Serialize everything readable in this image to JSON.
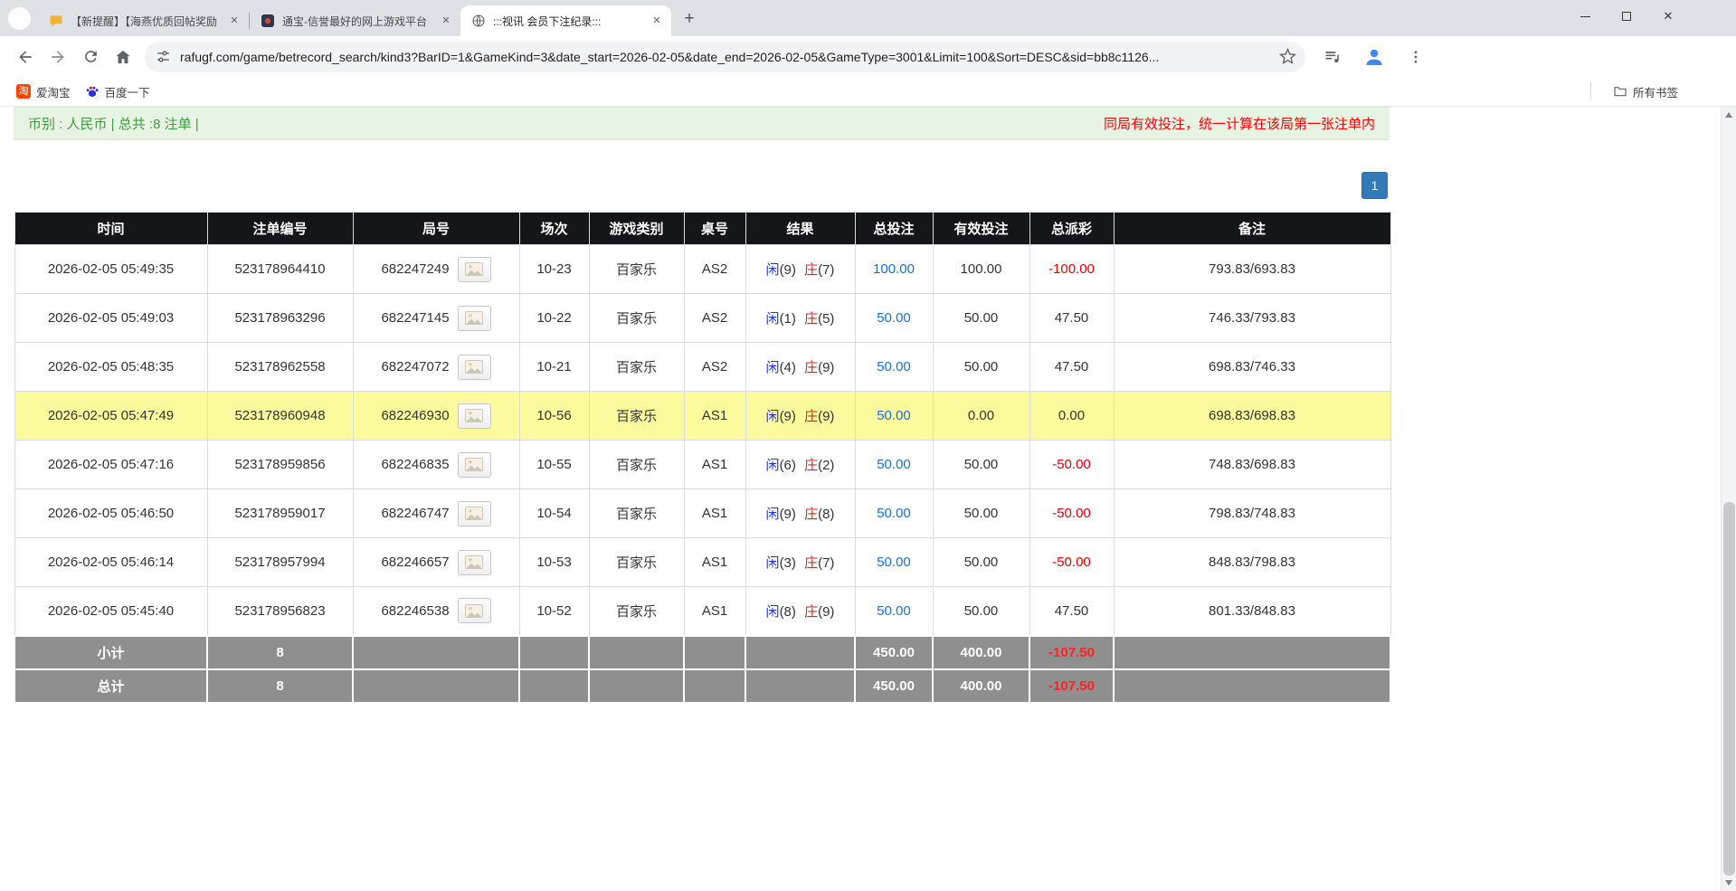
{
  "browser": {
    "tabs": [
      {
        "title": "【新提醒】【海燕优质回帖奖励"
      },
      {
        "title": "通宝-信誉最好的网上游戏平台"
      },
      {
        "title": ":::视讯 会员下注纪录:::"
      }
    ],
    "tab_close": "✕",
    "new_tab": "+",
    "window_close": "✕",
    "url": "rafugf.com/game/betrecord_search/kind3?BarID=1&GameKind=3&date_start=2026-02-05&date_end=2026-02-05&GameType=3001&Limit=100&Sort=DESC&sid=bb8c1126...",
    "bookmarks": [
      {
        "label": "爱淘宝",
        "icon_glyph": "淘"
      },
      {
        "label": "百度一下"
      }
    ],
    "all_bookmarks": "所有书签"
  },
  "icons": {
    "back": "arrow-left",
    "forward": "arrow-right",
    "refresh": "circular-arrow",
    "home": "house",
    "site-info": "sliders",
    "bookmark-star": "star-outline",
    "media-controls": "equalizer-note",
    "profile": "blue-person",
    "menu": "three-dots",
    "all-bookmarks": "folder",
    "active-tab": "globe",
    "replay": "picture"
  },
  "page": {
    "notice_left": "币别 : 人民币 | 总共 :8 注单 |",
    "notice_right": "同局有效投注，统一计算在该局第一张注单内",
    "pagination": "1"
  },
  "table": {
    "headers": [
      "时间",
      "注单编号",
      "局号",
      "场次",
      "游戏类别",
      "桌号",
      "结果",
      "总投注",
      "有效投注",
      "总派彩",
      "备注"
    ],
    "rows": [
      {
        "time": "2026-02-05 05:49:35",
        "bet_id": "523178964410",
        "round": "682247249",
        "session": "10-23",
        "game": "百家乐",
        "table_no": "AS2",
        "result_player": "闲(9)",
        "result_banker": "庄(7)",
        "total_bet": "100.00",
        "valid_bet": "100.00",
        "payout": "-100.00",
        "note": "793.83/693.83",
        "highlight": false
      },
      {
        "time": "2026-02-05 05:49:03",
        "bet_id": "523178963296",
        "round": "682247145",
        "session": "10-22",
        "game": "百家乐",
        "table_no": "AS2",
        "result_player": "闲(1)",
        "result_banker": "庄(5)",
        "total_bet": "50.00",
        "valid_bet": "50.00",
        "payout": "47.50",
        "note": "746.33/793.83",
        "highlight": false
      },
      {
        "time": "2026-02-05 05:48:35",
        "bet_id": "523178962558",
        "round": "682247072",
        "session": "10-21",
        "game": "百家乐",
        "table_no": "AS2",
        "result_player": "闲(4)",
        "result_banker": "庄(9)",
        "total_bet": "50.00",
        "valid_bet": "50.00",
        "payout": "47.50",
        "note": "698.83/746.33",
        "highlight": false
      },
      {
        "time": "2026-02-05 05:47:49",
        "bet_id": "523178960948",
        "round": "682246930",
        "session": "10-56",
        "game": "百家乐",
        "table_no": "AS1",
        "result_player": "闲(9)",
        "result_banker": "庄(9)",
        "total_bet": "50.00",
        "valid_bet": "0.00",
        "payout": "0.00",
        "note": "698.83/698.83",
        "highlight": true
      },
      {
        "time": "2026-02-05 05:47:16",
        "bet_id": "523178959856",
        "round": "682246835",
        "session": "10-55",
        "game": "百家乐",
        "table_no": "AS1",
        "result_player": "闲(6)",
        "result_banker": "庄(2)",
        "total_bet": "50.00",
        "valid_bet": "50.00",
        "payout": "-50.00",
        "note": "748.83/698.83",
        "highlight": false
      },
      {
        "time": "2026-02-05 05:46:50",
        "bet_id": "523178959017",
        "round": "682246747",
        "session": "10-54",
        "game": "百家乐",
        "table_no": "AS1",
        "result_player": "闲(9)",
        "result_banker": "庄(8)",
        "total_bet": "50.00",
        "valid_bet": "50.00",
        "payout": "-50.00",
        "note": "798.83/748.83",
        "highlight": false
      },
      {
        "time": "2026-02-05 05:46:14",
        "bet_id": "523178957994",
        "round": "682246657",
        "session": "10-53",
        "game": "百家乐",
        "table_no": "AS1",
        "result_player": "闲(3)",
        "result_banker": "庄(7)",
        "total_bet": "50.00",
        "valid_bet": "50.00",
        "payout": "-50.00",
        "note": "848.83/798.83",
        "highlight": false
      },
      {
        "time": "2026-02-05 05:45:40",
        "bet_id": "523178956823",
        "round": "682246538",
        "session": "10-52",
        "game": "百家乐",
        "table_no": "AS1",
        "result_player": "闲(8)",
        "result_banker": "庄(9)",
        "total_bet": "50.00",
        "valid_bet": "50.00",
        "payout": "47.50",
        "note": "801.33/848.83",
        "highlight": false
      }
    ],
    "footer": [
      {
        "label": "小计",
        "count": "8",
        "total_bet": "450.00",
        "valid_bet": "400.00",
        "payout": "-107.50"
      },
      {
        "label": "总计",
        "count": "8",
        "total_bet": "450.00",
        "valid_bet": "400.00",
        "payout": "-107.50"
      }
    ]
  }
}
